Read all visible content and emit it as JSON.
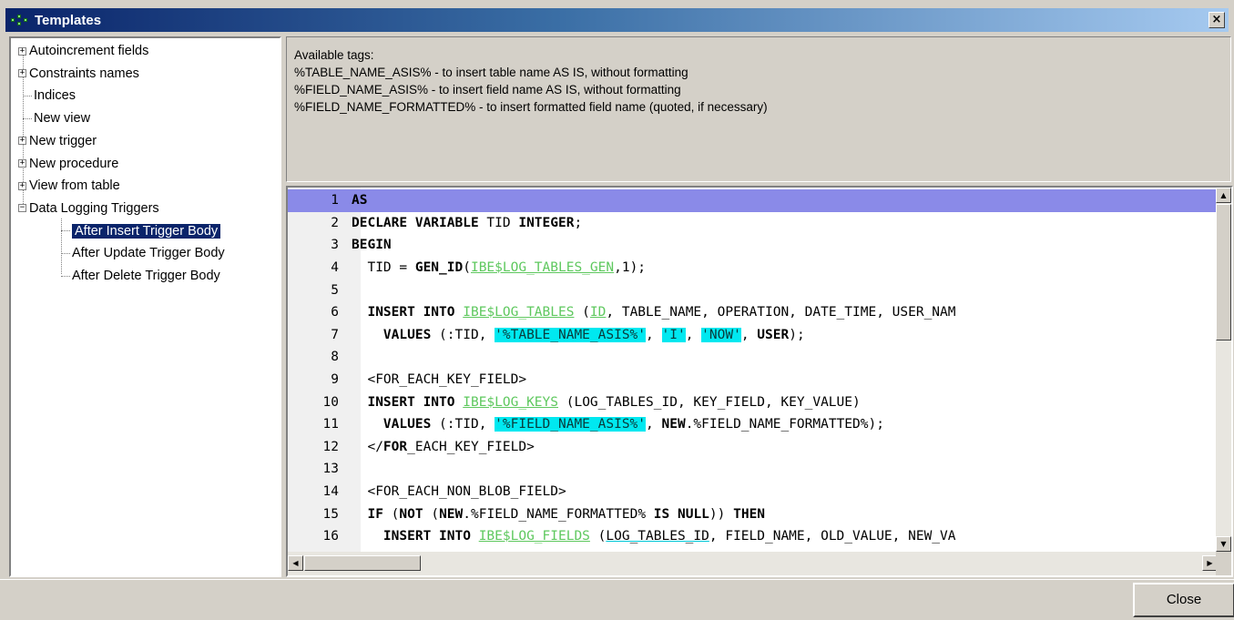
{
  "window": {
    "title": "Templates",
    "close_glyph": "×",
    "icon": "templates-icon"
  },
  "tree": {
    "items": [
      {
        "label": "Autoincrement fields",
        "expander": "+"
      },
      {
        "label": "Constraints names",
        "expander": "+"
      },
      {
        "label": "Indices",
        "expander": ""
      },
      {
        "label": "New view",
        "expander": ""
      },
      {
        "label": "New trigger",
        "expander": "+"
      },
      {
        "label": "New procedure",
        "expander": "+"
      },
      {
        "label": "View from table",
        "expander": "+"
      },
      {
        "label": "Data Logging Triggers",
        "expander": "−"
      }
    ],
    "children": [
      {
        "label": "After Insert Trigger Body",
        "selected": true
      },
      {
        "label": "After Update Trigger Body",
        "selected": false
      },
      {
        "label": "After Delete Trigger Body",
        "selected": false
      }
    ]
  },
  "info": {
    "heading": "Available tags:",
    "lines": [
      "%TABLE_NAME_ASIS% - to insert table name AS IS, without formatting",
      "%FIELD_NAME_ASIS% - to insert field name AS IS, without formatting",
      "%FIELD_NAME_FORMATTED% - to insert formatted field name (quoted, if necessary)"
    ]
  },
  "editor": {
    "active_line": 1,
    "lines": [
      {
        "n": "1",
        "tokens": [
          [
            "kw",
            "AS"
          ]
        ]
      },
      {
        "n": "2",
        "tokens": [
          [
            "kw",
            "DECLARE VARIABLE"
          ],
          [
            "",
            " TID "
          ],
          [
            "kw",
            "INTEGER"
          ],
          [
            "",
            ";"
          ]
        ]
      },
      {
        "n": "3",
        "tokens": [
          [
            "kw",
            "BEGIN"
          ]
        ]
      },
      {
        "n": "4",
        "tokens": [
          [
            "",
            "  TID = "
          ],
          [
            "kw",
            "GEN_ID"
          ],
          [
            "",
            "("
          ],
          [
            "tbl",
            "IBE$LOG_TABLES_GEN"
          ],
          [
            "",
            ",1);"
          ]
        ]
      },
      {
        "n": "5",
        "tokens": []
      },
      {
        "n": "6",
        "tokens": [
          [
            "",
            "  "
          ],
          [
            "kw",
            "INSERT INTO"
          ],
          [
            "",
            " "
          ],
          [
            "tbl",
            "IBE$LOG_TABLES"
          ],
          [
            "",
            " ("
          ],
          [
            "tbl",
            "ID"
          ],
          [
            "",
            ", TABLE_NAME, OPERATION, DATE_TIME, USER_NAM"
          ]
        ]
      },
      {
        "n": "7",
        "tokens": [
          [
            "",
            "    "
          ],
          [
            "kw",
            "VALUES"
          ],
          [
            "",
            " (:TID, "
          ],
          [
            "str",
            "'%TABLE_NAME_ASIS%'"
          ],
          [
            "",
            ", "
          ],
          [
            "str",
            "'I'"
          ],
          [
            "",
            ", "
          ],
          [
            "str",
            "'NOW'"
          ],
          [
            "",
            ", "
          ],
          [
            "kw",
            "USER"
          ],
          [
            "",
            ");"
          ]
        ]
      },
      {
        "n": "8",
        "tokens": []
      },
      {
        "n": "9",
        "tokens": [
          [
            "",
            "  <FOR_EACH_KEY_FIELD>"
          ]
        ]
      },
      {
        "n": "10",
        "tokens": [
          [
            "",
            "  "
          ],
          [
            "kw",
            "INSERT INTO"
          ],
          [
            "",
            " "
          ],
          [
            "tbl",
            "IBE$LOG_KEYS"
          ],
          [
            "",
            " (LOG_TABLES_ID, KEY_FIELD, KEY_VALUE)"
          ]
        ]
      },
      {
        "n": "11",
        "tokens": [
          [
            "",
            "    "
          ],
          [
            "kw",
            "VALUES"
          ],
          [
            "",
            " (:TID, "
          ],
          [
            "str",
            "'%FIELD_NAME_ASIS%'"
          ],
          [
            "",
            ", "
          ],
          [
            "kw",
            "NEW"
          ],
          [
            "",
            ".%FIELD_NAME_FORMATTED%);"
          ]
        ]
      },
      {
        "n": "12",
        "tokens": [
          [
            "",
            "  </"
          ],
          [
            "kw",
            "FOR"
          ],
          [
            "",
            "_EACH_KEY_FIELD>"
          ]
        ]
      },
      {
        "n": "13",
        "tokens": []
      },
      {
        "n": "14",
        "tokens": [
          [
            "",
            "  <FOR_EACH_NON_BLOB_FIELD>"
          ]
        ]
      },
      {
        "n": "15",
        "tokens": [
          [
            "",
            "  "
          ],
          [
            "kw",
            "IF"
          ],
          [
            "",
            " ("
          ],
          [
            "kw",
            "NOT"
          ],
          [
            "",
            " ("
          ],
          [
            "kw",
            "NEW"
          ],
          [
            "",
            ".%FIELD_NAME_FORMATTED% "
          ],
          [
            "kw",
            "IS NULL"
          ],
          [
            "",
            "))"
          ],
          [
            "kw",
            " THEN"
          ]
        ]
      },
      {
        "n": "16",
        "tokens": [
          [
            "",
            "    "
          ],
          [
            "kw",
            "INSERT INTO"
          ],
          [
            "",
            " "
          ],
          [
            "tbl",
            "IBE$LOG_FIELDS"
          ],
          [
            "",
            " ("
          ],
          [
            "under",
            "LOG_TABLES_ID"
          ],
          [
            "",
            ", FIELD_NAME, OLD_VALUE, NEW_VA"
          ]
        ]
      }
    ]
  },
  "buttons": {
    "close": "Close"
  },
  "scroll_glyphs": {
    "up": "▲",
    "down": "▼",
    "left": "◀",
    "right": "▶"
  }
}
